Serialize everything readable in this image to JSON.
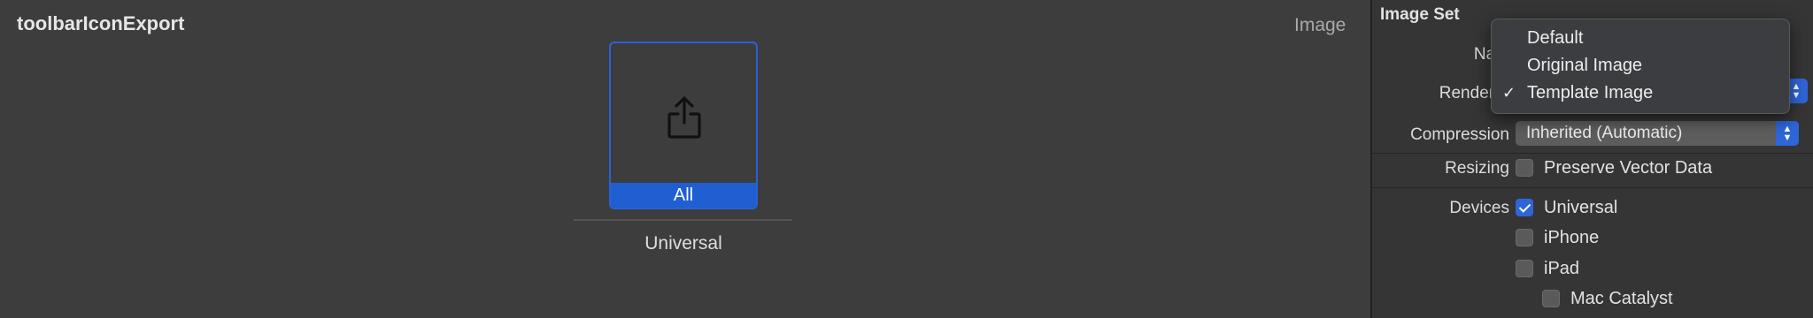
{
  "editor": {
    "asset_name": "toolbarIconExport",
    "kind_label": "Image",
    "slot": {
      "label": "All",
      "caption": "Universal",
      "icon": "share-icon"
    }
  },
  "inspector": {
    "section_title": "Image Set",
    "name_label": "Nam",
    "render_label": "Render A",
    "compression_label": "Compression",
    "compression_value": "Inherited (Automatic)",
    "resizing_label": "Resizing",
    "preserve_vector_label": "Preserve Vector Data",
    "preserve_vector_checked": false,
    "devices_label": "Devices",
    "devices": [
      {
        "label": "Universal",
        "checked": true
      },
      {
        "label": "iPhone",
        "checked": false
      },
      {
        "label": "iPad",
        "checked": false
      },
      {
        "label": "Mac Catalyst",
        "checked": false
      }
    ]
  },
  "render_menu": {
    "options": [
      "Default",
      "Original Image",
      "Template Image"
    ],
    "selected_index": 2,
    "check_glyph": "✓"
  },
  "colors": {
    "accent": "#2e65d8",
    "selection": "#1f5fd1"
  }
}
